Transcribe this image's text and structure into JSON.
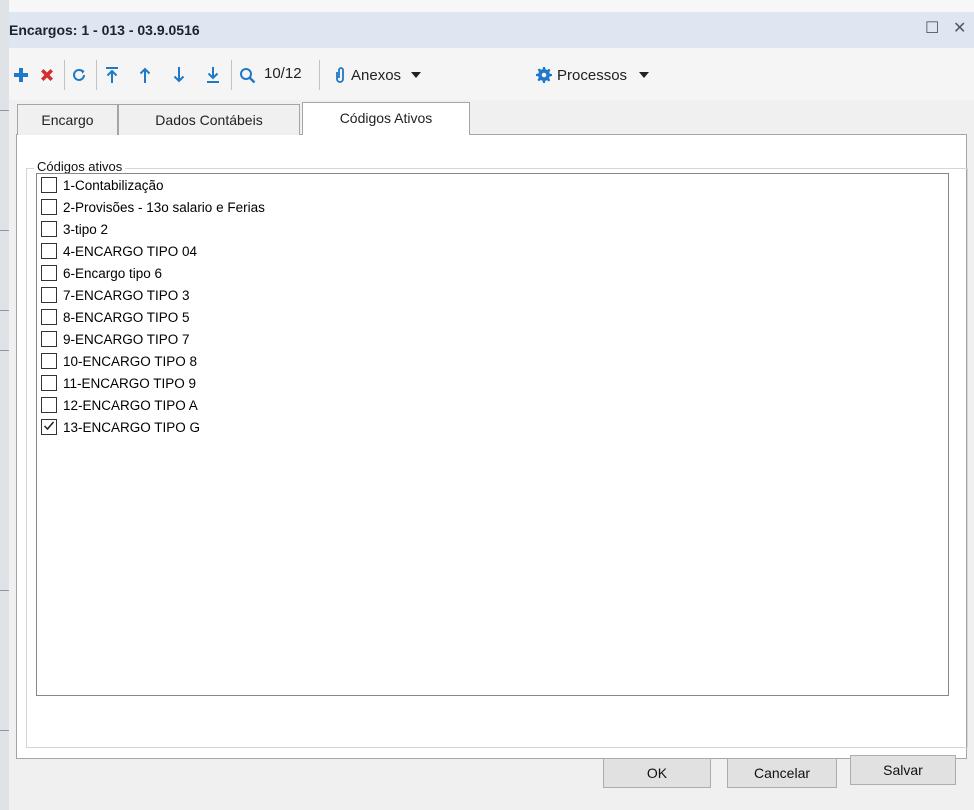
{
  "dialog": {
    "title": "Encargos: 1 - 013 - 03.9.0516",
    "maximize_glyph": "☐",
    "close_glyph": "✕"
  },
  "toolbar": {
    "add_icon": "plus-icon",
    "delete_icon": "delete-icon",
    "refresh_icon": "refresh-icon",
    "first_icon": "first-record-icon",
    "prev_icon": "previous-record-icon",
    "next_icon": "next-record-icon",
    "last_icon": "last-record-icon",
    "search_icon": "search-icon",
    "record_position": "10/12",
    "attachments_label": "Anexos",
    "processes_label": "Processos"
  },
  "tabs": [
    {
      "label": "Encargo",
      "active": false
    },
    {
      "label": "Dados Contábeis",
      "active": false
    },
    {
      "label": "Códigos Ativos",
      "active": true
    }
  ],
  "group": {
    "label": "Códigos ativos",
    "items": [
      {
        "label": "1-Contabilização",
        "checked": false
      },
      {
        "label": "2-Provisões - 13o salario e Ferias",
        "checked": false
      },
      {
        "label": "3-tipo 2",
        "checked": false
      },
      {
        "label": "4-ENCARGO TIPO 04",
        "checked": false
      },
      {
        "label": "6-Encargo tipo 6",
        "checked": false
      },
      {
        "label": "7-ENCARGO TIPO 3",
        "checked": false
      },
      {
        "label": "8-ENCARGO TIPO 5",
        "checked": false
      },
      {
        "label": "9-ENCARGO TIPO 7",
        "checked": false
      },
      {
        "label": "10-ENCARGO TIPO 8",
        "checked": false
      },
      {
        "label": "11-ENCARGO TIPO 9",
        "checked": false
      },
      {
        "label": "12-ENCARGO TIPO A",
        "checked": false
      },
      {
        "label": "13-ENCARGO TIPO G",
        "checked": true
      }
    ]
  },
  "buttons": {
    "ok": "OK",
    "cancel": "Cancelar",
    "save": "Salvar"
  },
  "colors": {
    "titlebar_bg": "#dde6f1",
    "add_blue": "#1f78c8",
    "delete_red": "#d32f2f",
    "nav_blue": "#1f78c8"
  }
}
